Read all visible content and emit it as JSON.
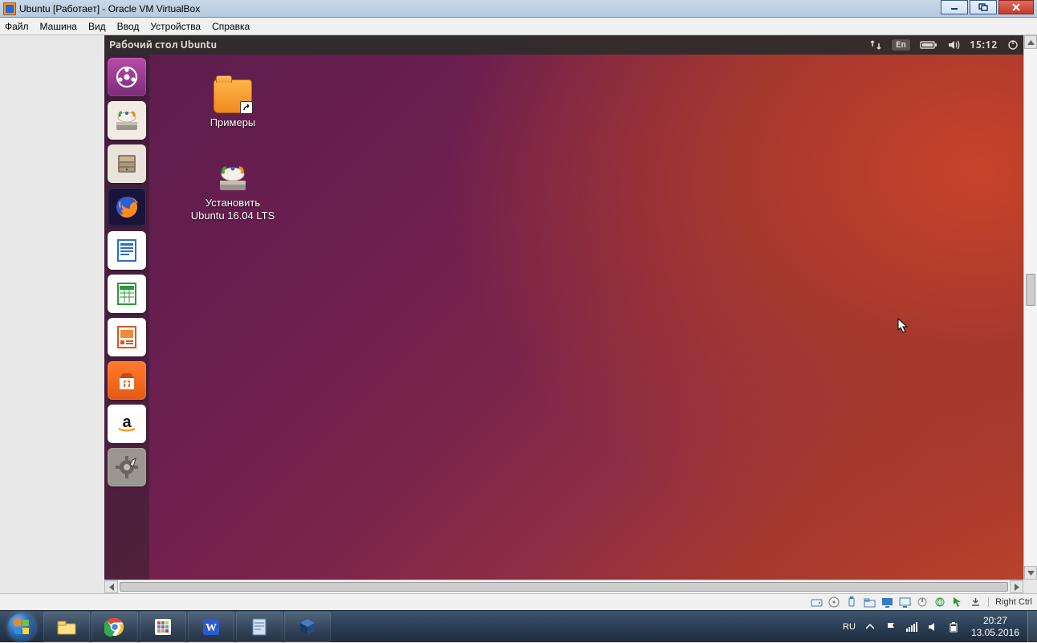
{
  "win": {
    "title": "Ubuntu [Работает] - Oracle VM VirtualBox"
  },
  "vb_menu": [
    "Файл",
    "Машина",
    "Вид",
    "Ввод",
    "Устройства",
    "Справка"
  ],
  "vb_status_hostkey": "Right Ctrl",
  "ubuntu": {
    "top_title": "Рабочий стол Ubuntu",
    "lang": "En",
    "clock": "15:12"
  },
  "launcher": [
    {
      "name": "dash",
      "label": "Dash"
    },
    {
      "name": "installer-drive",
      "label": "Installer"
    },
    {
      "name": "files",
      "label": "Files"
    },
    {
      "name": "firefox",
      "label": "Firefox"
    },
    {
      "name": "writer",
      "label": "LibreOffice Writer"
    },
    {
      "name": "calc",
      "label": "LibreOffice Calc"
    },
    {
      "name": "impress",
      "label": "LibreOffice Impress"
    },
    {
      "name": "software",
      "label": "Ubuntu Software"
    },
    {
      "name": "amazon",
      "label": "Amazon"
    },
    {
      "name": "settings",
      "label": "System Settings"
    }
  ],
  "desktop_icons": {
    "examples": "Примеры",
    "install": "Установить\nUbuntu 16.04 LTS"
  },
  "host_tray": {
    "lang": "RU",
    "time": "20:27",
    "date": "13.05.2016"
  }
}
